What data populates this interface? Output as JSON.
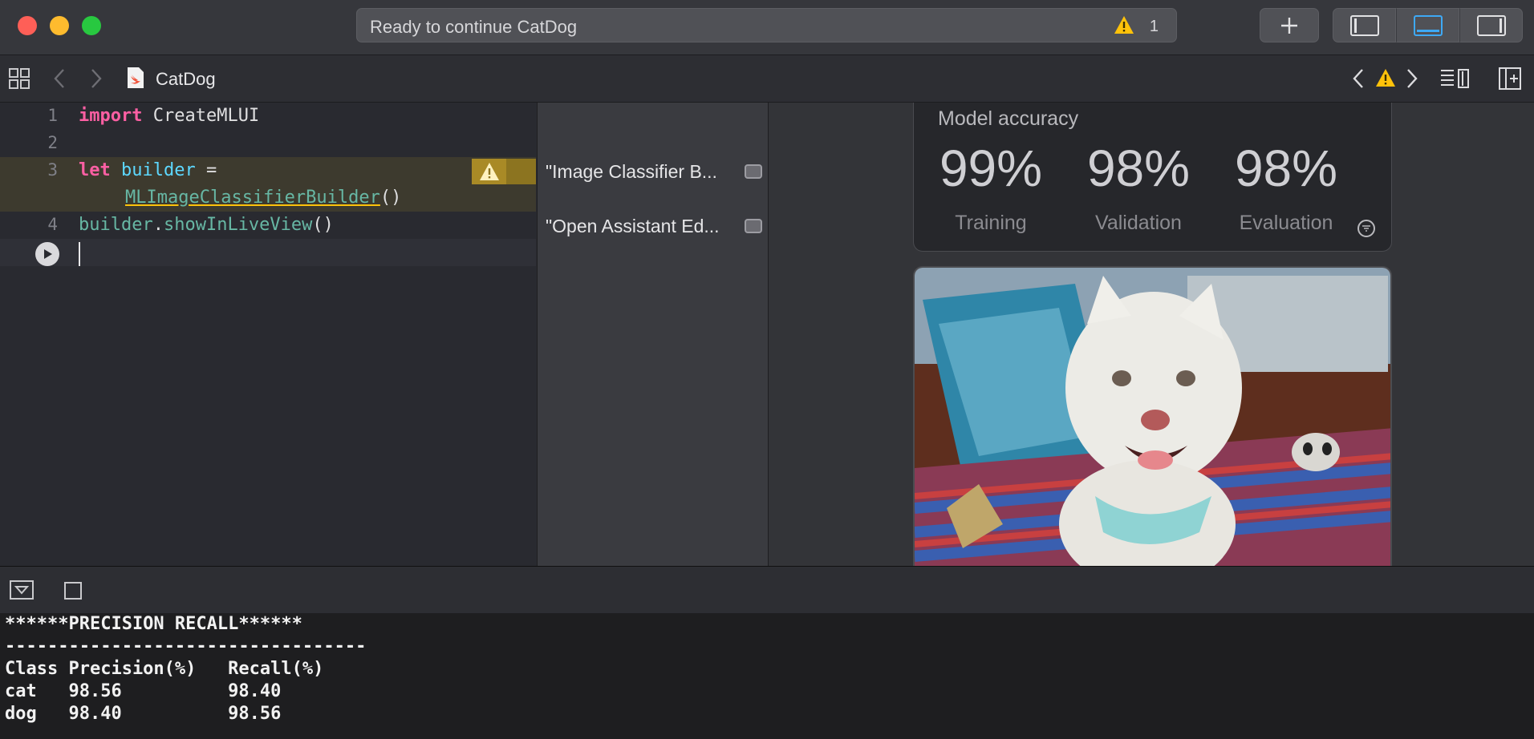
{
  "window": {
    "activity_text": "Ready to continue CatDog",
    "warning_count": "1",
    "add_icon": "plus-icon",
    "panel_icons": [
      "navigator-toggle-icon",
      "debug-area-toggle-icon",
      "inspector-toggle-icon"
    ]
  },
  "jumpbar": {
    "file_name": "CatDog",
    "file_icon": "swift-playground-file-icon"
  },
  "editor": {
    "lines": [
      {
        "num": "1"
      },
      {
        "num": "2"
      },
      {
        "num": "3"
      },
      {
        "num": "4"
      }
    ],
    "tokens": {
      "import_kw": "import",
      "module": "CreateMLUI",
      "let_kw": "let",
      "var_name": "builder",
      "eq": " =",
      "builder_type": "MLImageClassifierBuilder",
      "call_parens": "()",
      "call_target": "builder",
      "dot": ".",
      "method": "showInLiveView",
      "method_parens": "()"
    }
  },
  "results": [
    {
      "text": "\"Image Classifier B..."
    },
    {
      "text": "\"Open Assistant Ed..."
    }
  ],
  "liveview": {
    "title": "Model accuracy",
    "metrics": [
      {
        "value": "99%",
        "label": "Training"
      },
      {
        "value": "98%",
        "label": "Validation"
      },
      {
        "value": "98%",
        "label": "Evaluation"
      }
    ]
  },
  "console": {
    "lines": [
      "******PRECISION RECALL******",
      "----------------------------------",
      "Class Precision(%)   Recall(%)",
      "cat   98.56          98.40",
      "dog   98.40          98.56"
    ]
  },
  "colors": {
    "keyword": "#fc5fa3",
    "type": "#5dd8ff",
    "function": "#67b7a4",
    "warning": "#ffc20a"
  }
}
